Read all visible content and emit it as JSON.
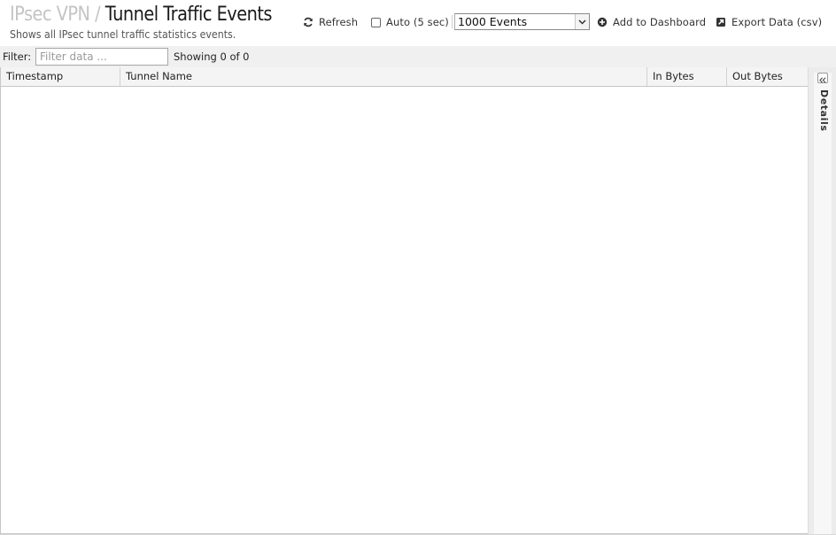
{
  "header": {
    "breadcrumb_parent": "IPsec VPN",
    "breadcrumb_separator": "/",
    "title": "Tunnel Traffic Events",
    "subtitle": "Shows all IPsec tunnel traffic statistics events."
  },
  "toolbar": {
    "refresh_label": "Refresh",
    "refresh_icon": "refresh-icon",
    "auto_label": "Auto (5 sec)",
    "auto_checked": false,
    "events_select_value": "1000 Events",
    "add_dashboard_label": "Add to Dashboard",
    "add_dashboard_icon": "plus-circle-icon",
    "export_label": "Export Data (csv)",
    "export_icon": "export-icon"
  },
  "filter": {
    "label": "Filter:",
    "placeholder": "Filter data ...",
    "value": "",
    "showing_text": "Showing 0 of 0"
  },
  "table": {
    "columns": [
      "Timestamp",
      "Tunnel Name",
      "In Bytes",
      "Out Bytes"
    ],
    "rows": []
  },
  "details_panel": {
    "label": "Details",
    "collapsed": true
  },
  "colors": {
    "breadcrumb_muted": "#c4c4c4",
    "title": "#1a1a1a",
    "toolbar_bg": "#f0f0f0",
    "header_cell_bg": "#f4f4f4",
    "panel_bg": "#ececec"
  }
}
